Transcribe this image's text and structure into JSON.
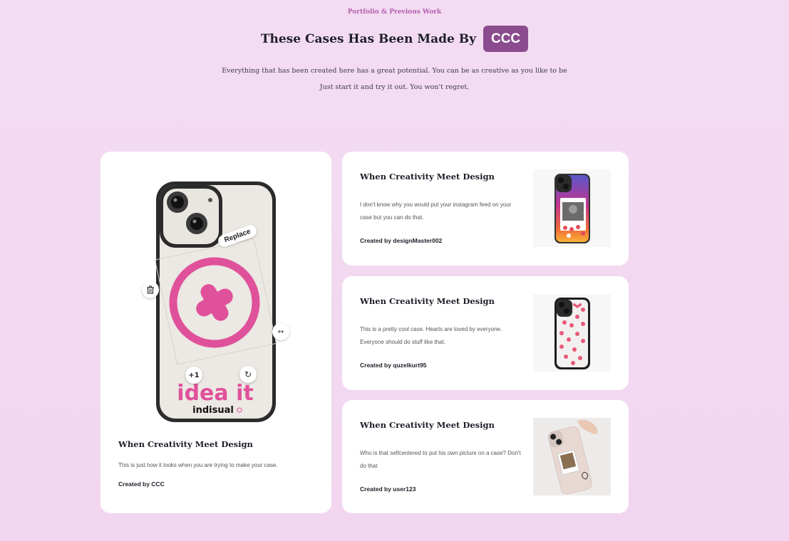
{
  "header": {
    "eyebrow": "Portfolio & Previous Work",
    "title": "These Cases Has Been Made By",
    "badge": "CCC",
    "subtitle_line1": "Everything that has been created here has a great potential. You can be as creative as you like to be",
    "subtitle_line2": "Just start it and try it out. You won't regret."
  },
  "featured": {
    "title": "When Creativity Meet Design",
    "description": "This is just how it looks when you are trying to make your case.",
    "author": "Created by CCC",
    "mockup": {
      "replace_label": "Replace",
      "plus_label": "+1",
      "brand_text": "idea it",
      "brand_sub": "indisual",
      "icons": [
        "trash-icon",
        "resize-icon",
        "rotate-icon",
        "plus-one-icon"
      ]
    }
  },
  "cards": [
    {
      "title": "When Creativity Meet Design",
      "description": "I don't know why you would put your instagram feed on your case but you can do that.",
      "author": "Created by designMaster002"
    },
    {
      "title": "When Creativity Meet Design",
      "description": "This is a pretty cool case. Hearts are loved by everyone. Everyone should do stuff like that.",
      "author": "Created by quzelkurt95"
    },
    {
      "title": "When Creativity Meet Design",
      "description": "Who is that selfcentered to put his own picture on a case? Don't do that",
      "author": "Created by user123"
    }
  ],
  "colors": {
    "background": "#f3dcf1",
    "accent": "#b45fb1",
    "badge": "#8a4c8e",
    "brand_pink": "#e0519b"
  }
}
